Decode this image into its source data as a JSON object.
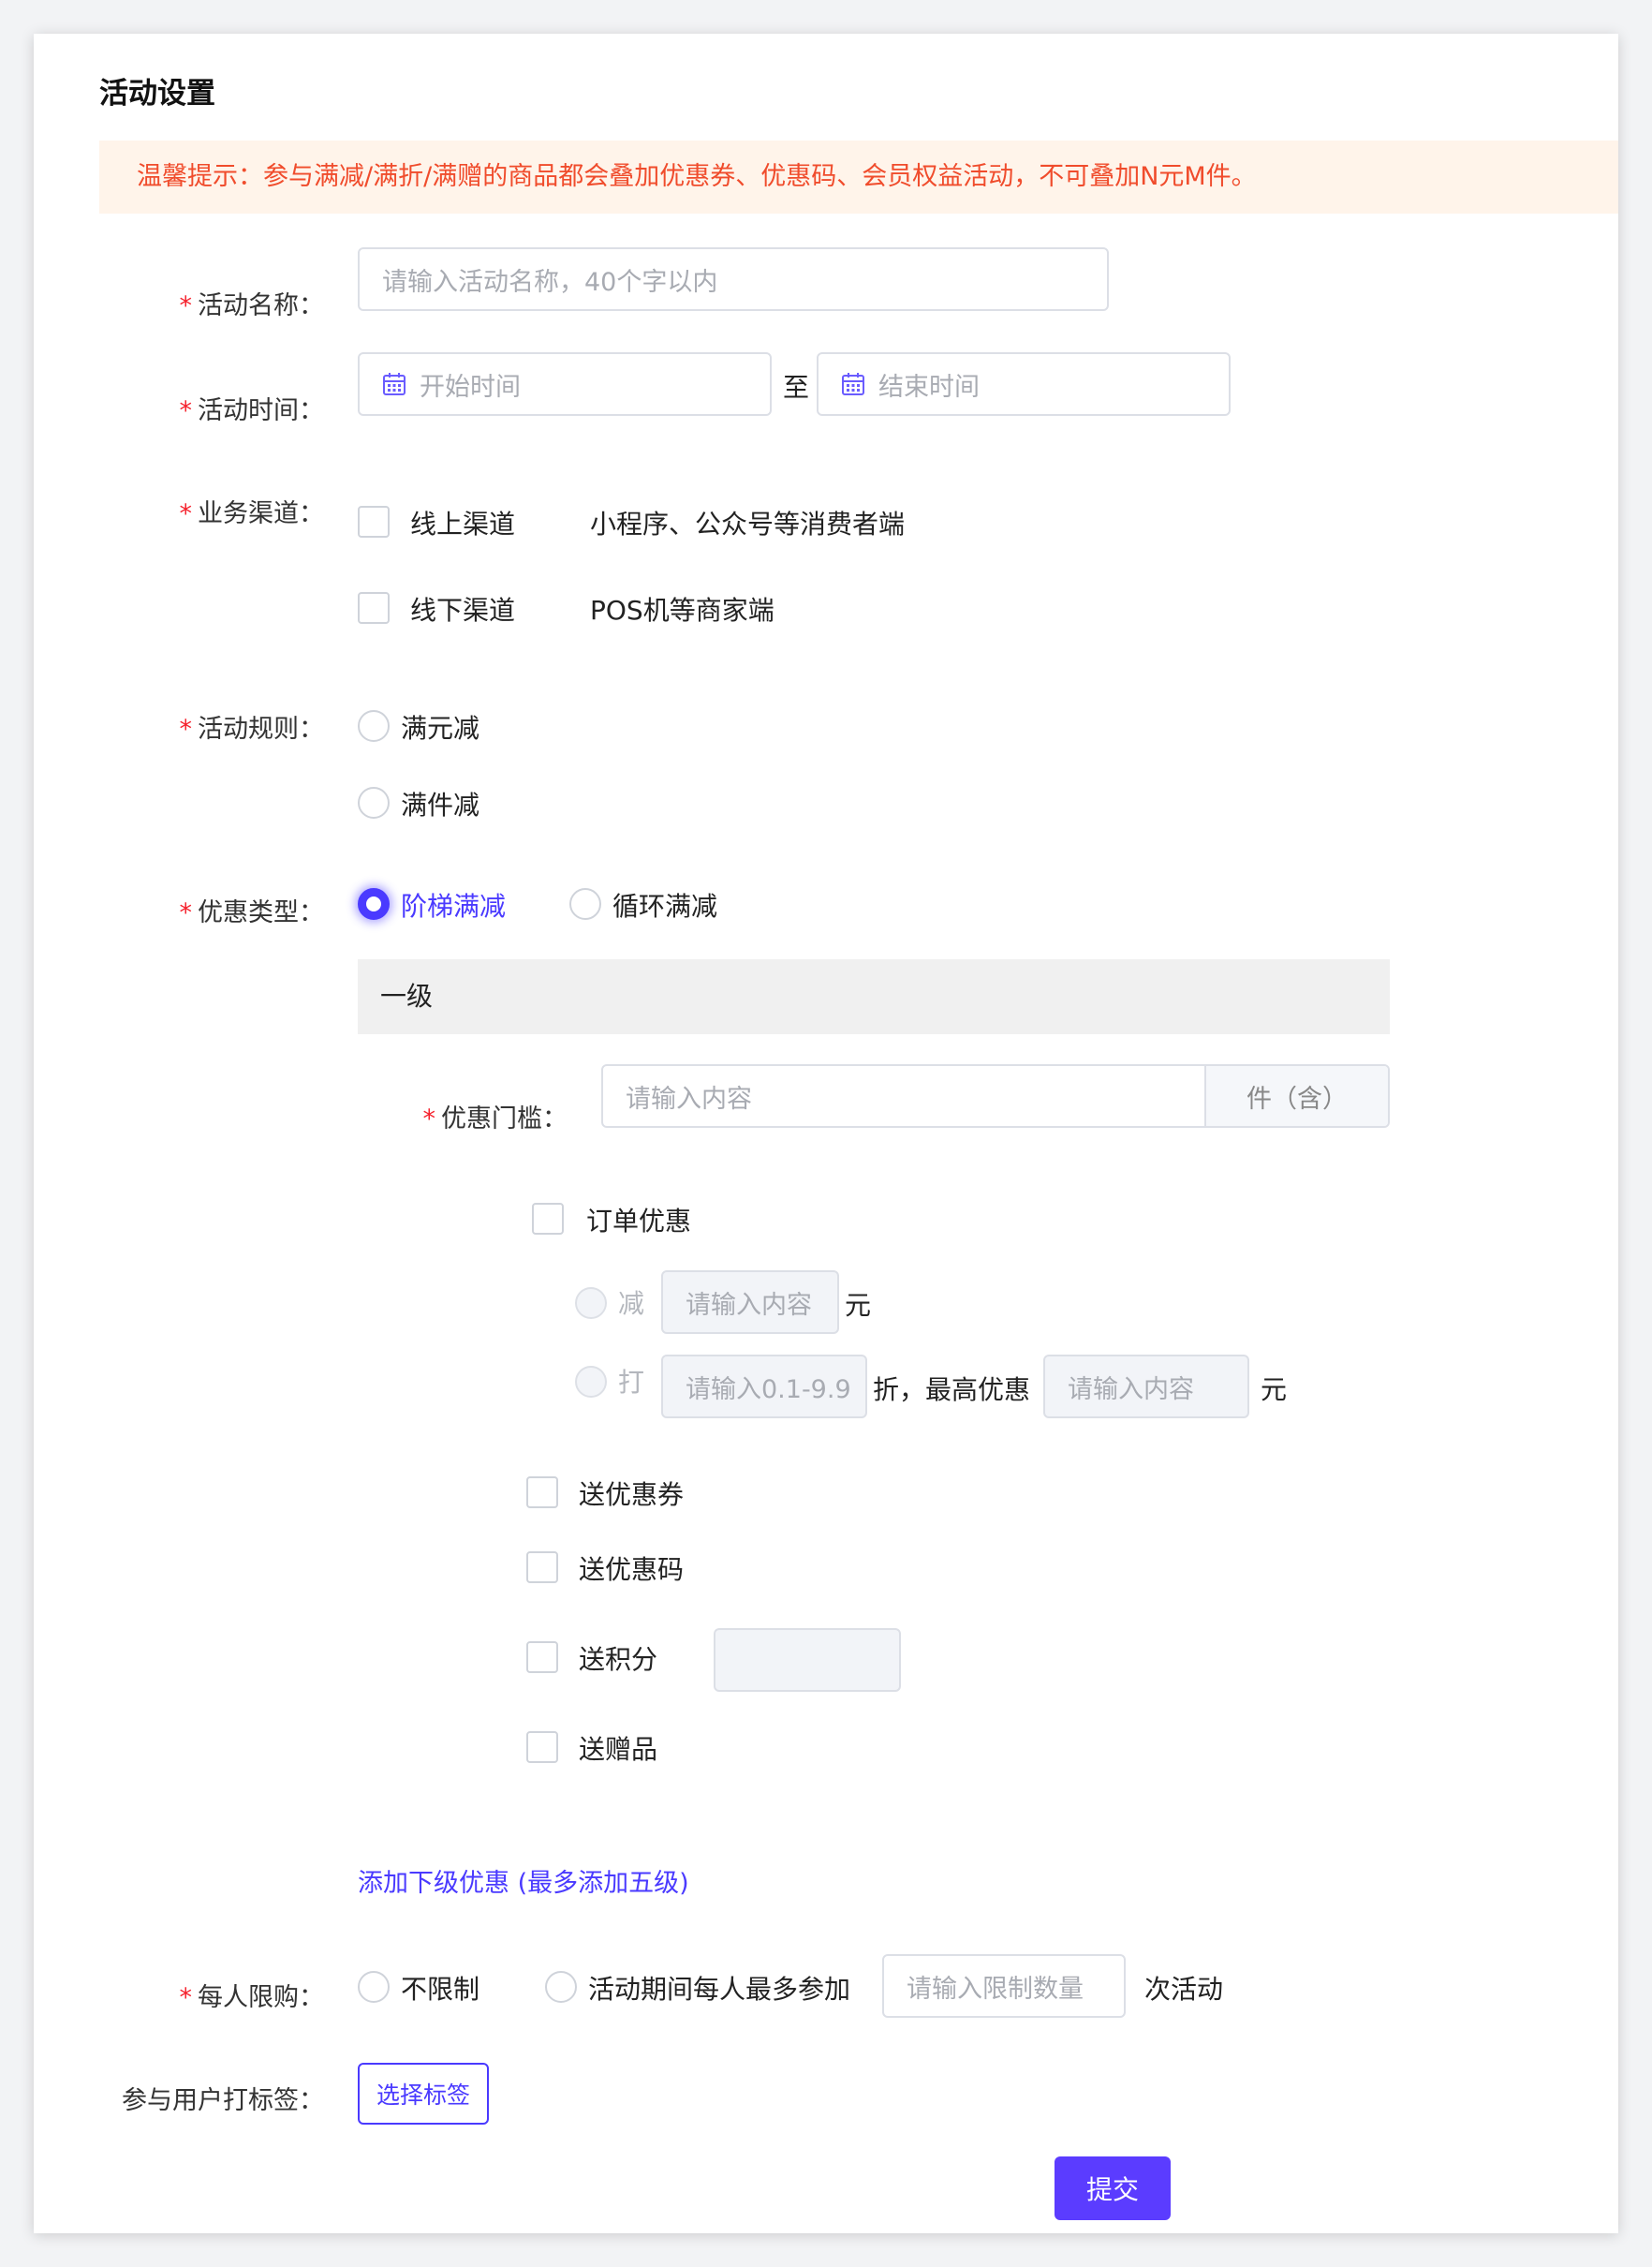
{
  "title": "活动设置",
  "tip": "温馨提示：参与满减/满折/满赠的商品都会叠加优惠券、优惠码、会员权益活动，不可叠加N元M件。",
  "required_mark": "*",
  "activity_name": {
    "label": "活动名称：",
    "placeholder": "请输入活动名称，40个字以内"
  },
  "activity_time": {
    "label": "活动时间：",
    "start_placeholder": "开始时间",
    "separator": "至",
    "end_placeholder": "结束时间"
  },
  "channel": {
    "label": "业务渠道：",
    "options": [
      {
        "name": "线上渠道",
        "desc": "小程序、公众号等消费者端",
        "checked": false
      },
      {
        "name": "线下渠道",
        "desc": "POS机等商家端",
        "checked": false
      }
    ]
  },
  "rule": {
    "label": "活动规则：",
    "options": [
      "满元减",
      "满件减"
    ]
  },
  "discount_type": {
    "label": "优惠类型：",
    "options": [
      "阶梯满减",
      "循环满减"
    ],
    "selected": "阶梯满减"
  },
  "level": {
    "title": "一级",
    "threshold_label": "优惠门槛：",
    "threshold_placeholder": "请输入内容",
    "threshold_unit": "件（含）",
    "order_discount": "订单优惠",
    "reduce_label": "减",
    "reduce_placeholder": "请输入内容",
    "reduce_unit": "元",
    "rate_label": "打",
    "rate_placeholder": "请输入0.1-9.9",
    "rate_unit": "折，最高优惠",
    "max_placeholder": "请输入内容",
    "max_unit": "元",
    "gifts": [
      "送优惠券",
      "送优惠码",
      "送积分",
      "送赠品"
    ]
  },
  "add_level_link": "添加下级优惠 (最多添加五级)",
  "limit": {
    "label": "每人限购：",
    "option_unlimited": "不限制",
    "option_max": "活动期间每人最多参加",
    "placeholder": "请输入限制数量",
    "suffix": "次活动"
  },
  "tag": {
    "label": "参与用户打标签：",
    "button": "选择标签"
  },
  "submit": "提交",
  "colors": {
    "accent": "#4a3aff",
    "required": "#f5222d",
    "tip_text": "#f04c2c",
    "tip_bg": "#fff4ea"
  }
}
